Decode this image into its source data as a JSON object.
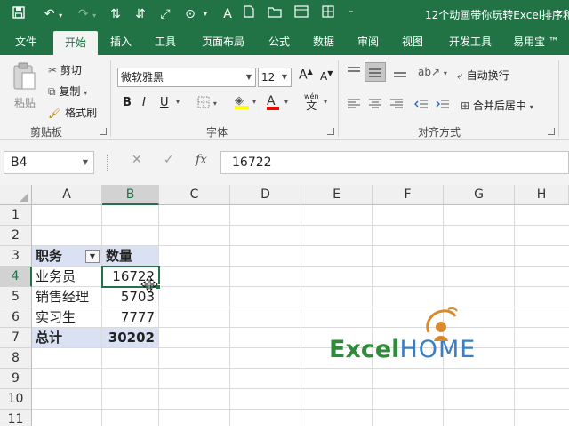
{
  "window": {
    "title": "12个动画带你玩转Excel排序和"
  },
  "qat": {
    "save_icon": "save-icon",
    "undo_icon": "undo-icon",
    "redo_icon": "redo-icon"
  },
  "tabs": [
    {
      "label": "文件"
    },
    {
      "label": "开始"
    },
    {
      "label": "插入"
    },
    {
      "label": "工具"
    },
    {
      "label": "页面布局"
    },
    {
      "label": "公式"
    },
    {
      "label": "数据"
    },
    {
      "label": "审阅"
    },
    {
      "label": "视图"
    },
    {
      "label": "开发工具"
    },
    {
      "label": "易用宝 ™"
    }
  ],
  "ribbon": {
    "clipboard": {
      "paste": "粘贴",
      "cut": "剪切",
      "copy": "复制",
      "format_painter": "格式刷",
      "label": "剪贴板"
    },
    "font": {
      "name": "微软雅黑",
      "size": "12",
      "bold": "B",
      "italic": "I",
      "underline": "U",
      "wen": "wén",
      "wen_char": "文",
      "label": "字体",
      "grow": "A",
      "shrink": "A"
    },
    "align": {
      "wrap": "自动换行",
      "merge": "合并后居中",
      "label": "对齐方式"
    }
  },
  "formula_bar": {
    "name_box": "B4",
    "fx": "fx",
    "value": "16722"
  },
  "columns": [
    "A",
    "B",
    "C",
    "D",
    "E",
    "F",
    "G",
    "H"
  ],
  "rows": [
    "1",
    "2",
    "3",
    "4",
    "5",
    "6",
    "7",
    "8",
    "9",
    "10",
    "11"
  ],
  "table": {
    "header": {
      "a": "职务",
      "b": "数量"
    },
    "rows": [
      {
        "a": "业务员",
        "b": "16722"
      },
      {
        "a": "销售经理",
        "b": "5703"
      },
      {
        "a": "实习生",
        "b": "7777"
      }
    ],
    "total": {
      "a": "总计",
      "b": "30202"
    }
  },
  "logo": {
    "part1": "Excel",
    "part2": "HOME"
  },
  "colors": {
    "accent": "#217346",
    "table_band": "#d9e1f2"
  }
}
